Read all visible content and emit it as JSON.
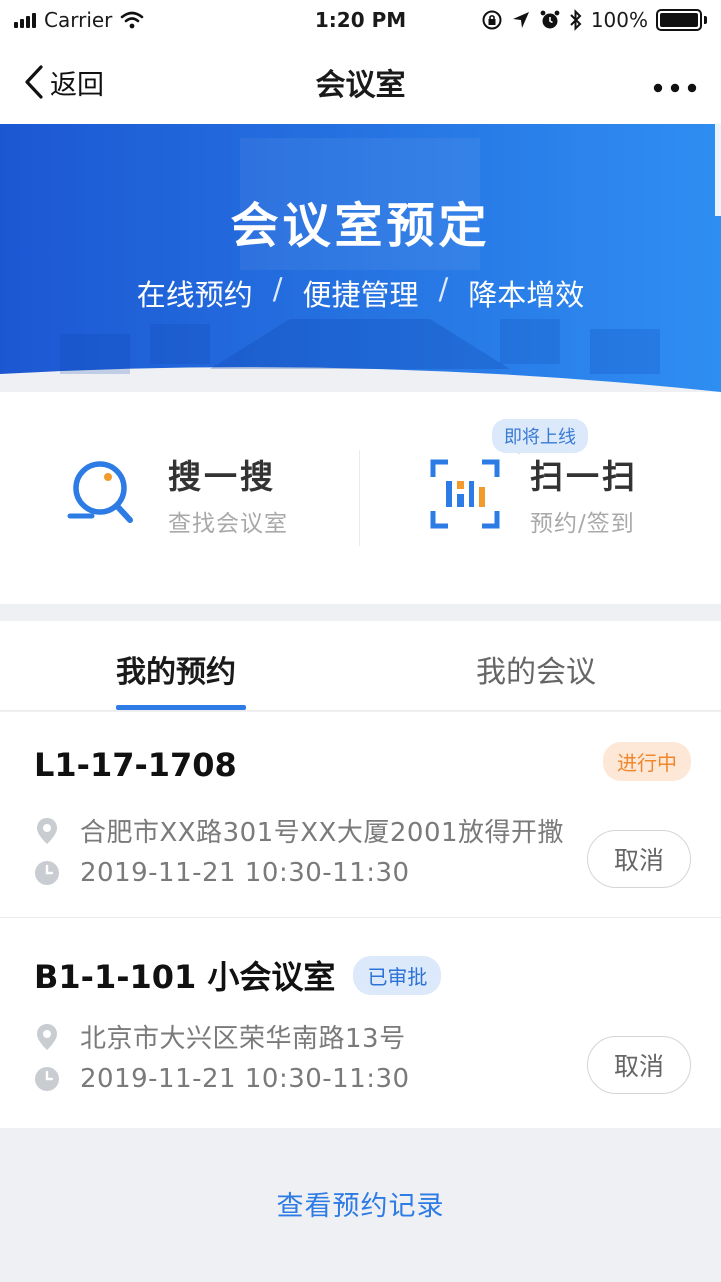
{
  "status_bar": {
    "carrier": "Carrier",
    "time": "1:20 PM",
    "battery": "100%"
  },
  "nav": {
    "back_label": "返回",
    "title": "会议室",
    "more_label": "•••"
  },
  "banner": {
    "title": "会议室预定",
    "subtitle_parts": [
      "在线预约",
      "便捷管理",
      "降本增效"
    ],
    "separator": "/"
  },
  "actions": {
    "search": {
      "title": "搜一搜",
      "subtitle": "查找会议室",
      "icon": "search-icon"
    },
    "scan": {
      "title": "扫一扫",
      "subtitle": "预约/签到",
      "icon": "scan-icon",
      "badge": "即将上线"
    }
  },
  "tabs": [
    {
      "label": "我的预约",
      "active": true
    },
    {
      "label": "我的会议",
      "active": false
    }
  ],
  "reservations": [
    {
      "room": "L1-17-1708",
      "status": "进行中",
      "status_color": "#f0882e",
      "address": "合肥市XX路301号XX大厦2001放得开撒",
      "time": "2019-11-21 10:30-11:30",
      "action": "取消"
    },
    {
      "room": "B1-1-101 小会议室",
      "status": "已审批",
      "status_color": "#2d72d6",
      "address": "北京市大兴区荣华南路13号",
      "time": "2019-11-21 10:30-11:30",
      "action": "取消"
    }
  ],
  "footer": {
    "link_label": "查看预约记录"
  },
  "colors": {
    "accent": "#2d7be5",
    "banner_start": "#1f5fd6",
    "banner_end": "#2f8bf0"
  }
}
